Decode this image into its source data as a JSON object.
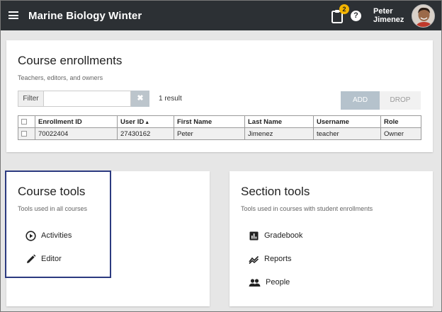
{
  "app": {
    "title": "Marine Biology Winter",
    "notification_count": "2",
    "help_symbol": "?",
    "user_first": "Peter",
    "user_last": "Jimenez"
  },
  "enrollments": {
    "title": "Course enrollments",
    "subtitle": "Teachers, editors, and owners",
    "filter_label": "Filter",
    "filter_value": "",
    "filter_placeholder": "",
    "result_count": "1 result",
    "add_label": "ADD",
    "drop_label": "DROP",
    "columns": [
      "Enrollment ID",
      "User ID",
      "First Name",
      "Last Name",
      "Username",
      "Role"
    ],
    "sorted_column": "User ID",
    "rows": [
      [
        "70022404",
        "27430162",
        "Peter",
        "Jimenez",
        "teacher",
        "Owner"
      ]
    ]
  },
  "course_tools": {
    "title": "Course tools",
    "subtitle": "Tools used in all courses",
    "items": [
      {
        "label": "Activities",
        "icon": "play-circle-icon"
      },
      {
        "label": "Editor",
        "icon": "pencil-icon"
      }
    ]
  },
  "section_tools": {
    "title": "Section tools",
    "subtitle": "Tools used in courses with student enrollments",
    "items": [
      {
        "label": "Gradebook",
        "icon": "bar-chart-icon"
      },
      {
        "label": "Reports",
        "icon": "trend-icon"
      },
      {
        "label": "People",
        "icon": "people-icon"
      }
    ]
  },
  "colors": {
    "topbar": "#2c3034",
    "badge": "#f4b400",
    "highlight_border": "#2c3a80",
    "add_button": "#b5c2cc"
  }
}
